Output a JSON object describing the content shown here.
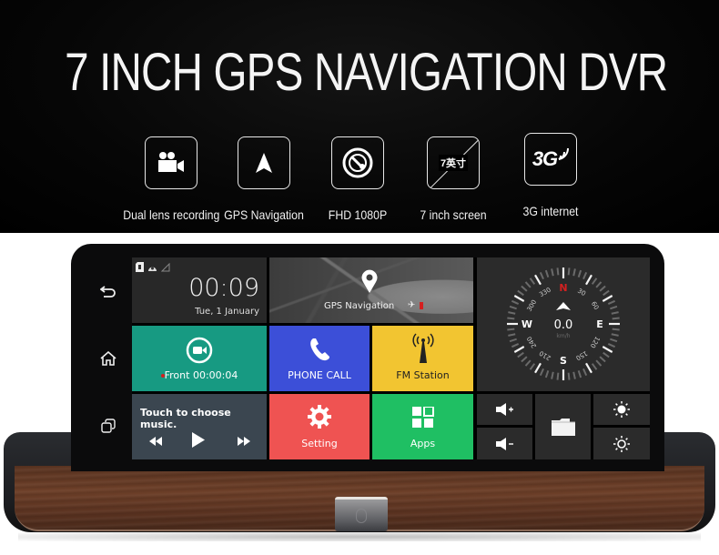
{
  "banner": {
    "title": "7 INCH GPS NAVIGATION DVR",
    "features": [
      {
        "icon": "video-camera-icon",
        "label": "Dual lens recording"
      },
      {
        "icon": "navigation-arrow-icon",
        "label": "GPS Navigation"
      },
      {
        "icon": "hd-lens-icon",
        "label": "FHD 1080P"
      },
      {
        "icon": "screen-size-icon",
        "label": "7 inch screen",
        "badge": "7英寸"
      },
      {
        "icon": "3g-signal-icon",
        "label": "3G internet",
        "badge": "3G"
      }
    ]
  },
  "device": {
    "sidenav": [
      {
        "icon": "back-icon",
        "glyph": "↩"
      },
      {
        "icon": "home-icon",
        "glyph": "⌂"
      },
      {
        "icon": "recent-apps-icon",
        "glyph": "❐"
      }
    ],
    "screen": {
      "clock": {
        "time": "00:09",
        "date": "Tue, 1 January"
      },
      "map": {
        "label": "GPS Navigation"
      },
      "compass": {
        "speed": "0.0",
        "unit": "km/h",
        "cardinals": {
          "n": "N",
          "e": "E",
          "s": "S",
          "w": "W"
        },
        "degrees": [
          "30",
          "60",
          "120",
          "150",
          "210",
          "240",
          "300",
          "330"
        ]
      },
      "recorder": {
        "label": "Front 00:00:04"
      },
      "phone": {
        "label": "PHONE CALL"
      },
      "fm": {
        "label": "FM Station"
      },
      "music": {
        "title": "Touch to choose music."
      },
      "setting": {
        "label": "Setting"
      },
      "apps": {
        "label": "Apps"
      },
      "controls": [
        "volume-up",
        "volume-down",
        "file-manager",
        "brightness-up",
        "brightness-down"
      ]
    }
  },
  "colors": {
    "recorder": "#179a82",
    "phone": "#3c4fd8",
    "fm": "#f2c531",
    "setting": "#ef5352",
    "apps": "#1fbf63",
    "music": "#3b4650",
    "compass_north": "#d42020"
  }
}
